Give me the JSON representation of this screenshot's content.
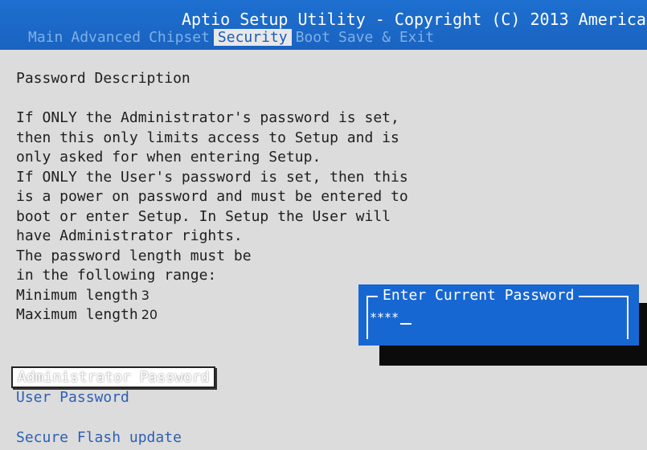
{
  "header": {
    "title": "Aptio Setup Utility - Copyright (C) 2013 America",
    "tabs": [
      {
        "label": "Main",
        "active": false
      },
      {
        "label": "Advanced",
        "active": false
      },
      {
        "label": "Chipset",
        "active": false
      },
      {
        "label": "Security",
        "active": true
      },
      {
        "label": "Boot",
        "active": false
      },
      {
        "label": "Save & Exit",
        "active": false
      }
    ]
  },
  "description": {
    "heading": "Password Description",
    "lines": [
      "If ONLY the Administrator's password is set,",
      "then this only limits access to Setup and is",
      "only asked for when entering Setup.",
      "If ONLY the User's password is set, then this",
      "is a power on password and must be entered to",
      "boot or enter Setup. In Setup the User will",
      "have Administrator rights.",
      "The password length must be",
      "in the following range:"
    ],
    "min_label": "Minimum length",
    "min_value": "3",
    "max_label": "Maximum length",
    "max_value": "20"
  },
  "menu": {
    "admin_password": "Administrator Password",
    "user_password": "User Password",
    "secure_flash": "Secure Flash update"
  },
  "dialog": {
    "title": "Enter Current Password",
    "masked_value": "****"
  },
  "colors": {
    "bios_blue": "#1767d2",
    "background": "#dcdcdc",
    "link_blue": "#2c5fb5"
  }
}
